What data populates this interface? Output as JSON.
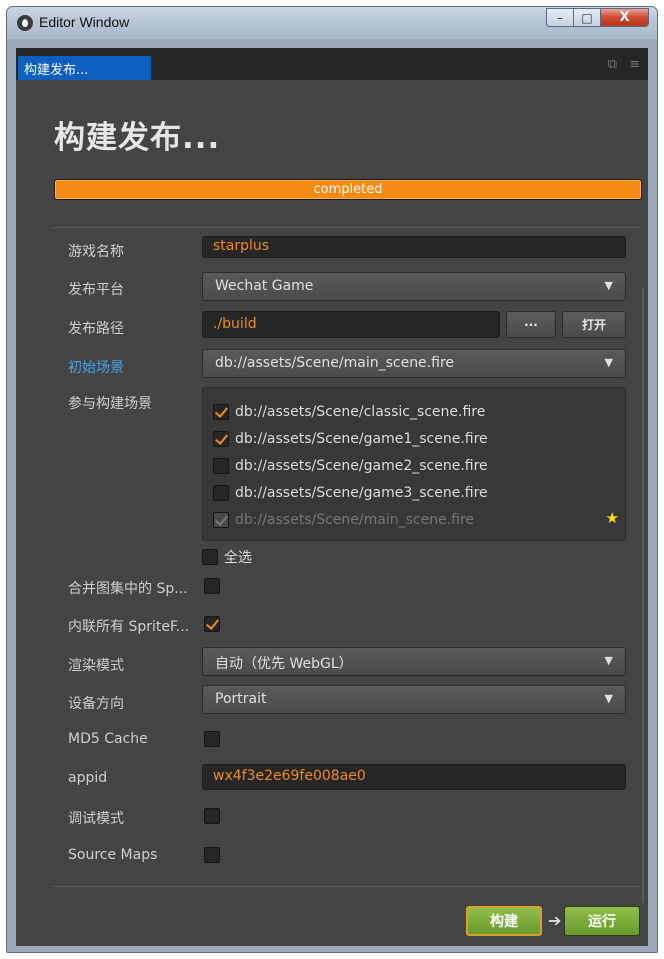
{
  "window": {
    "title": "Editor Window",
    "minimize": "–",
    "maximize": "□",
    "close": "X"
  },
  "tab": {
    "label": "构建发布..."
  },
  "page": {
    "title": "构建发布..."
  },
  "progress": {
    "text": "completed",
    "percent": 100
  },
  "form": {
    "game_name_label": "游戏名称",
    "game_name_value": "starplus",
    "platform_label": "发布平台",
    "platform_value": "Wechat Game",
    "path_label": "发布路径",
    "path_value": "./build",
    "browse_button": "···",
    "open_button": "打开",
    "start_scene_label": "初始场景",
    "start_scene_value": "db://assets/Scene/main_scene.fire",
    "scenes_label": "参与构建场景",
    "scenes": [
      {
        "name": "db://assets/Scene/classic_scene.fire",
        "checked": true
      },
      {
        "name": "db://assets/Scene/game1_scene.fire",
        "checked": true
      },
      {
        "name": "db://assets/Scene/game2_scene.fire",
        "checked": false
      },
      {
        "name": "db://assets/Scene/game3_scene.fire",
        "checked": false
      },
      {
        "name": "db://assets/Scene/main_scene.fire",
        "checked": true,
        "disabled": true
      }
    ],
    "select_all_label": "全选",
    "merge_atlas_label": "合并图集中的 Sp...",
    "inline_sprite_label": "内联所有 SpriteF...",
    "render_mode_label": "渲染模式",
    "render_mode_value": "自动（优先 WebGL）",
    "orientation_label": "设备方向",
    "orientation_value": "Portrait",
    "md5_label": "MD5 Cache",
    "appid_label": "appid",
    "appid_value": "wx4f3e2e69fe008ae0",
    "debug_label": "调试模式",
    "sourcemaps_label": "Source Maps"
  },
  "footer": {
    "build_button": "构建",
    "arrow": "➔",
    "run_button": "运行"
  },
  "colors": {
    "accent": "#f58a12",
    "tab_blue": "#0d5fbf",
    "button_green": "#7aab38",
    "link_blue": "#4aa3e8"
  }
}
